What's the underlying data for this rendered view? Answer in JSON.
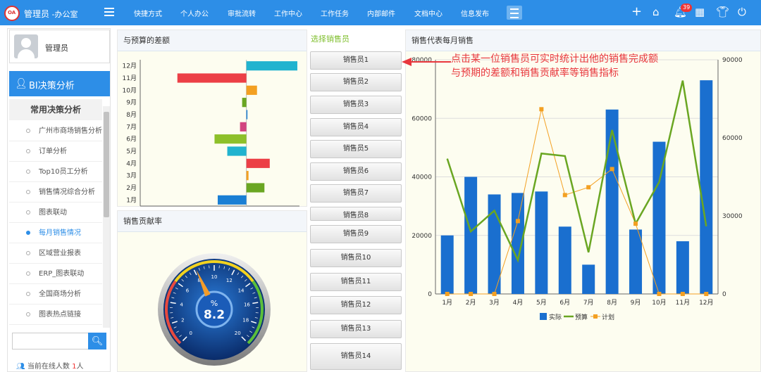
{
  "header": {
    "app_title": "管理员",
    "app_subtitle": "-办公室",
    "nav": [
      "快捷方式",
      "个人办公",
      "审批流转",
      "工作中心",
      "工作任务",
      "内部邮件",
      "文档中心",
      "信息发布"
    ],
    "notification_count": "39"
  },
  "sidebar": {
    "user_name": "管理员",
    "module_title": "BI决策分析",
    "category_title": "常用决策分析",
    "items": [
      "广州市商场销售分析",
      "订单分析",
      "Top10员工分析",
      "销售情况综合分析",
      "图表联动",
      "每月销售情况",
      "区域营业报表",
      "ERP_图表联动",
      "全国商场分析",
      "图表热点链接"
    ],
    "active_item": "每月销售情况",
    "search_placeholder": "",
    "online_label": "当前在线人数",
    "online_count": "1",
    "online_unit": "人"
  },
  "panels": {
    "diff_title": "与预算的差额",
    "contrib_title": "销售贡献率",
    "selector_title": "选择销售员",
    "monthly_title": "销售代表每月销售"
  },
  "salespeople": [
    "销售员1",
    "销售员2",
    "销售员3",
    "销售员4",
    "销售员5",
    "销售员6",
    "销售员7",
    "销售员8",
    "销售员9",
    "销售员10",
    "销售员11",
    "销售员12",
    "销售员13",
    "销售员14"
  ],
  "annotation": {
    "line1": "点击某一位销售员可实时统计出他的销售完成额",
    "line2": "与预期的差额和销售贡献率等销售指标"
  },
  "colors": {
    "accent": "#2d8ee7",
    "actual": "#1a6fcf",
    "budget": "#6aa622",
    "plan": "#f3a022",
    "annotation": "#e8363c"
  },
  "chart_data": [
    {
      "type": "bar",
      "orientation": "horizontal",
      "categories": [
        "1月",
        "2月",
        "3月",
        "4月",
        "5月",
        "6月",
        "7月",
        "8月",
        "9月",
        "10月",
        "11月",
        "12月"
      ],
      "values": [
        -27000,
        17000,
        2000,
        22000,
        -18000,
        -30000,
        -6000,
        1000,
        -4000,
        10000,
        -65000,
        48000
      ],
      "bar_colors": [
        "#1a7fd4",
        "#6aa622",
        "#f3a022",
        "#ec3f46",
        "#21b3cf",
        "#8dc02a",
        "#d2447f",
        "#1a7fd4",
        "#6aa622",
        "#f3a022",
        "#ec3f46",
        "#21b3cf"
      ],
      "xticks": [
        "-100000",
        "-50000",
        "0",
        "50000"
      ],
      "xlim": [
        -100000,
        50000
      ]
    },
    {
      "type": "gauge",
      "value": 8.2,
      "value_label": "8.2",
      "unit": "%",
      "range": [
        0,
        20
      ],
      "ticks": [
        "0",
        "2",
        "4",
        "6",
        "8",
        "10",
        "12",
        "14",
        "16",
        "18",
        "20"
      ]
    },
    {
      "type": "bar",
      "categories": [
        "1月",
        "2月",
        "3月",
        "4月",
        "5月",
        "6月",
        "7月",
        "8月",
        "9月",
        "10月",
        "11月",
        "12月"
      ],
      "series": [
        {
          "name": "实际",
          "type": "bar",
          "axis": "left",
          "values": [
            20000,
            40000,
            34000,
            34500,
            35000,
            23000,
            10000,
            63000,
            22000,
            52000,
            18000,
            73000
          ]
        },
        {
          "name": "预算",
          "type": "line",
          "axis": "right",
          "values": [
            52000,
            24000,
            32000,
            13000,
            54000,
            53000,
            16000,
            63000,
            27000,
            43000,
            82000,
            26000
          ]
        },
        {
          "name": "计划",
          "type": "line",
          "axis": "right",
          "values": [
            0,
            0,
            0,
            28000,
            71000,
            38000,
            41000,
            48000,
            27000,
            0,
            0,
            0
          ]
        }
      ],
      "y_left": {
        "range": [
          0,
          80000
        ],
        "ticks": [
          "0",
          "20000",
          "40000",
          "60000",
          "80000"
        ]
      },
      "y_right": {
        "range": [
          0,
          90000
        ],
        "ticks": [
          "0",
          "30000",
          "60000",
          "90000"
        ]
      },
      "legend": "bottom"
    }
  ]
}
